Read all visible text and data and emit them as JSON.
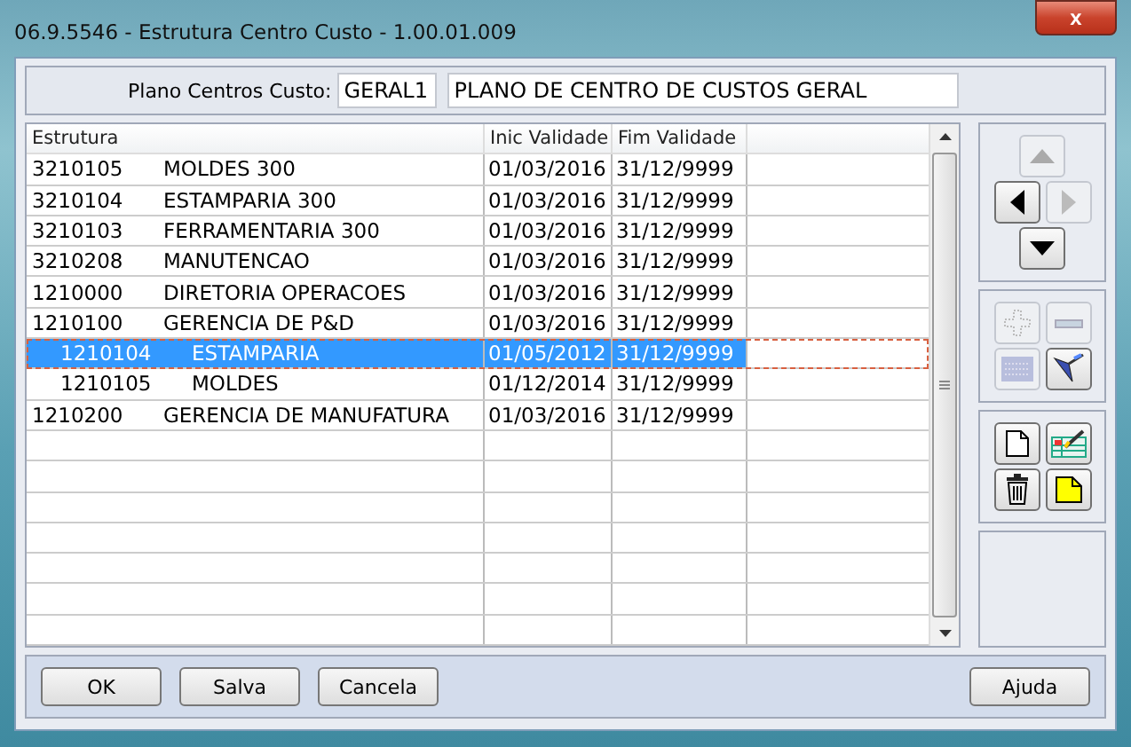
{
  "window": {
    "title": "06.9.5546 - Estrutura Centro Custo - 1.00.01.009",
    "close": "x"
  },
  "plan": {
    "label": "Plano Centros Custo:",
    "code": "GERAL1",
    "description": "PLANO DE CENTRO DE CUSTOS GERAL"
  },
  "table": {
    "columns": [
      "Estrutura",
      "Inic Validade",
      "Fim Validade"
    ],
    "rows": [
      {
        "code": "3210105",
        "name": "MOLDES 300",
        "start": "01/03/2016",
        "end": "31/12/9999",
        "selected": false
      },
      {
        "code": "3210104",
        "name": "ESTAMPARIA 300",
        "start": "01/03/2016",
        "end": "31/12/9999",
        "selected": false
      },
      {
        "code": "3210103",
        "name": "FERRAMENTARIA 300",
        "start": "01/03/2016",
        "end": "31/12/9999",
        "selected": false
      },
      {
        "code": "3210208",
        "name": "MANUTENCAO",
        "start": "01/03/2016",
        "end": "31/12/9999",
        "selected": false
      },
      {
        "code": "1210000",
        "name": "DIRETORIA OPERACOES",
        "start": "01/03/2016",
        "end": "31/12/9999",
        "selected": false
      },
      {
        "code": "1210100",
        "name": "GERENCIA DE P&D",
        "start": "01/03/2016",
        "end": "31/12/9999",
        "selected": false,
        "children": [
          {
            "code": "1210104",
            "name": "ESTAMPARIA",
            "start": "01/05/2012",
            "end": "31/12/9999",
            "selected": true
          },
          {
            "code": "1210105",
            "name": "MOLDES",
            "start": "01/12/2014",
            "end": "31/12/9999",
            "selected": false
          }
        ]
      },
      {
        "code": "1210200",
        "name": "GERENCIA DE MANUFATURA",
        "start": "01/03/2016",
        "end": "31/12/9999",
        "selected": false
      }
    ]
  },
  "toolbar": {
    "groups": [
      {
        "kind": "nav",
        "tools": [
          {
            "kind": "up",
            "disabled": true
          },
          {
            "kind": "left",
            "disabled": false
          },
          {
            "kind": "right",
            "disabled": true
          },
          {
            "kind": "down",
            "disabled": false
          }
        ]
      },
      {
        "kind": "grid",
        "tools": [
          {
            "kind": "add",
            "disabled": true
          },
          {
            "kind": "remove",
            "disabled": true
          },
          {
            "kind": "expand",
            "disabled": true
          },
          {
            "kind": "edit",
            "disabled": false
          }
        ]
      },
      {
        "kind": "grid",
        "tools": [
          {
            "kind": "new",
            "disabled": false
          },
          {
            "kind": "sheet",
            "disabled": false
          },
          {
            "kind": "delete",
            "disabled": false
          },
          {
            "kind": "note",
            "disabled": false
          }
        ]
      }
    ]
  },
  "buttons": [
    {
      "label": "OK"
    },
    {
      "label": "Salva"
    },
    {
      "label": "Cancela"
    },
    {
      "label": "Ajuda"
    }
  ]
}
